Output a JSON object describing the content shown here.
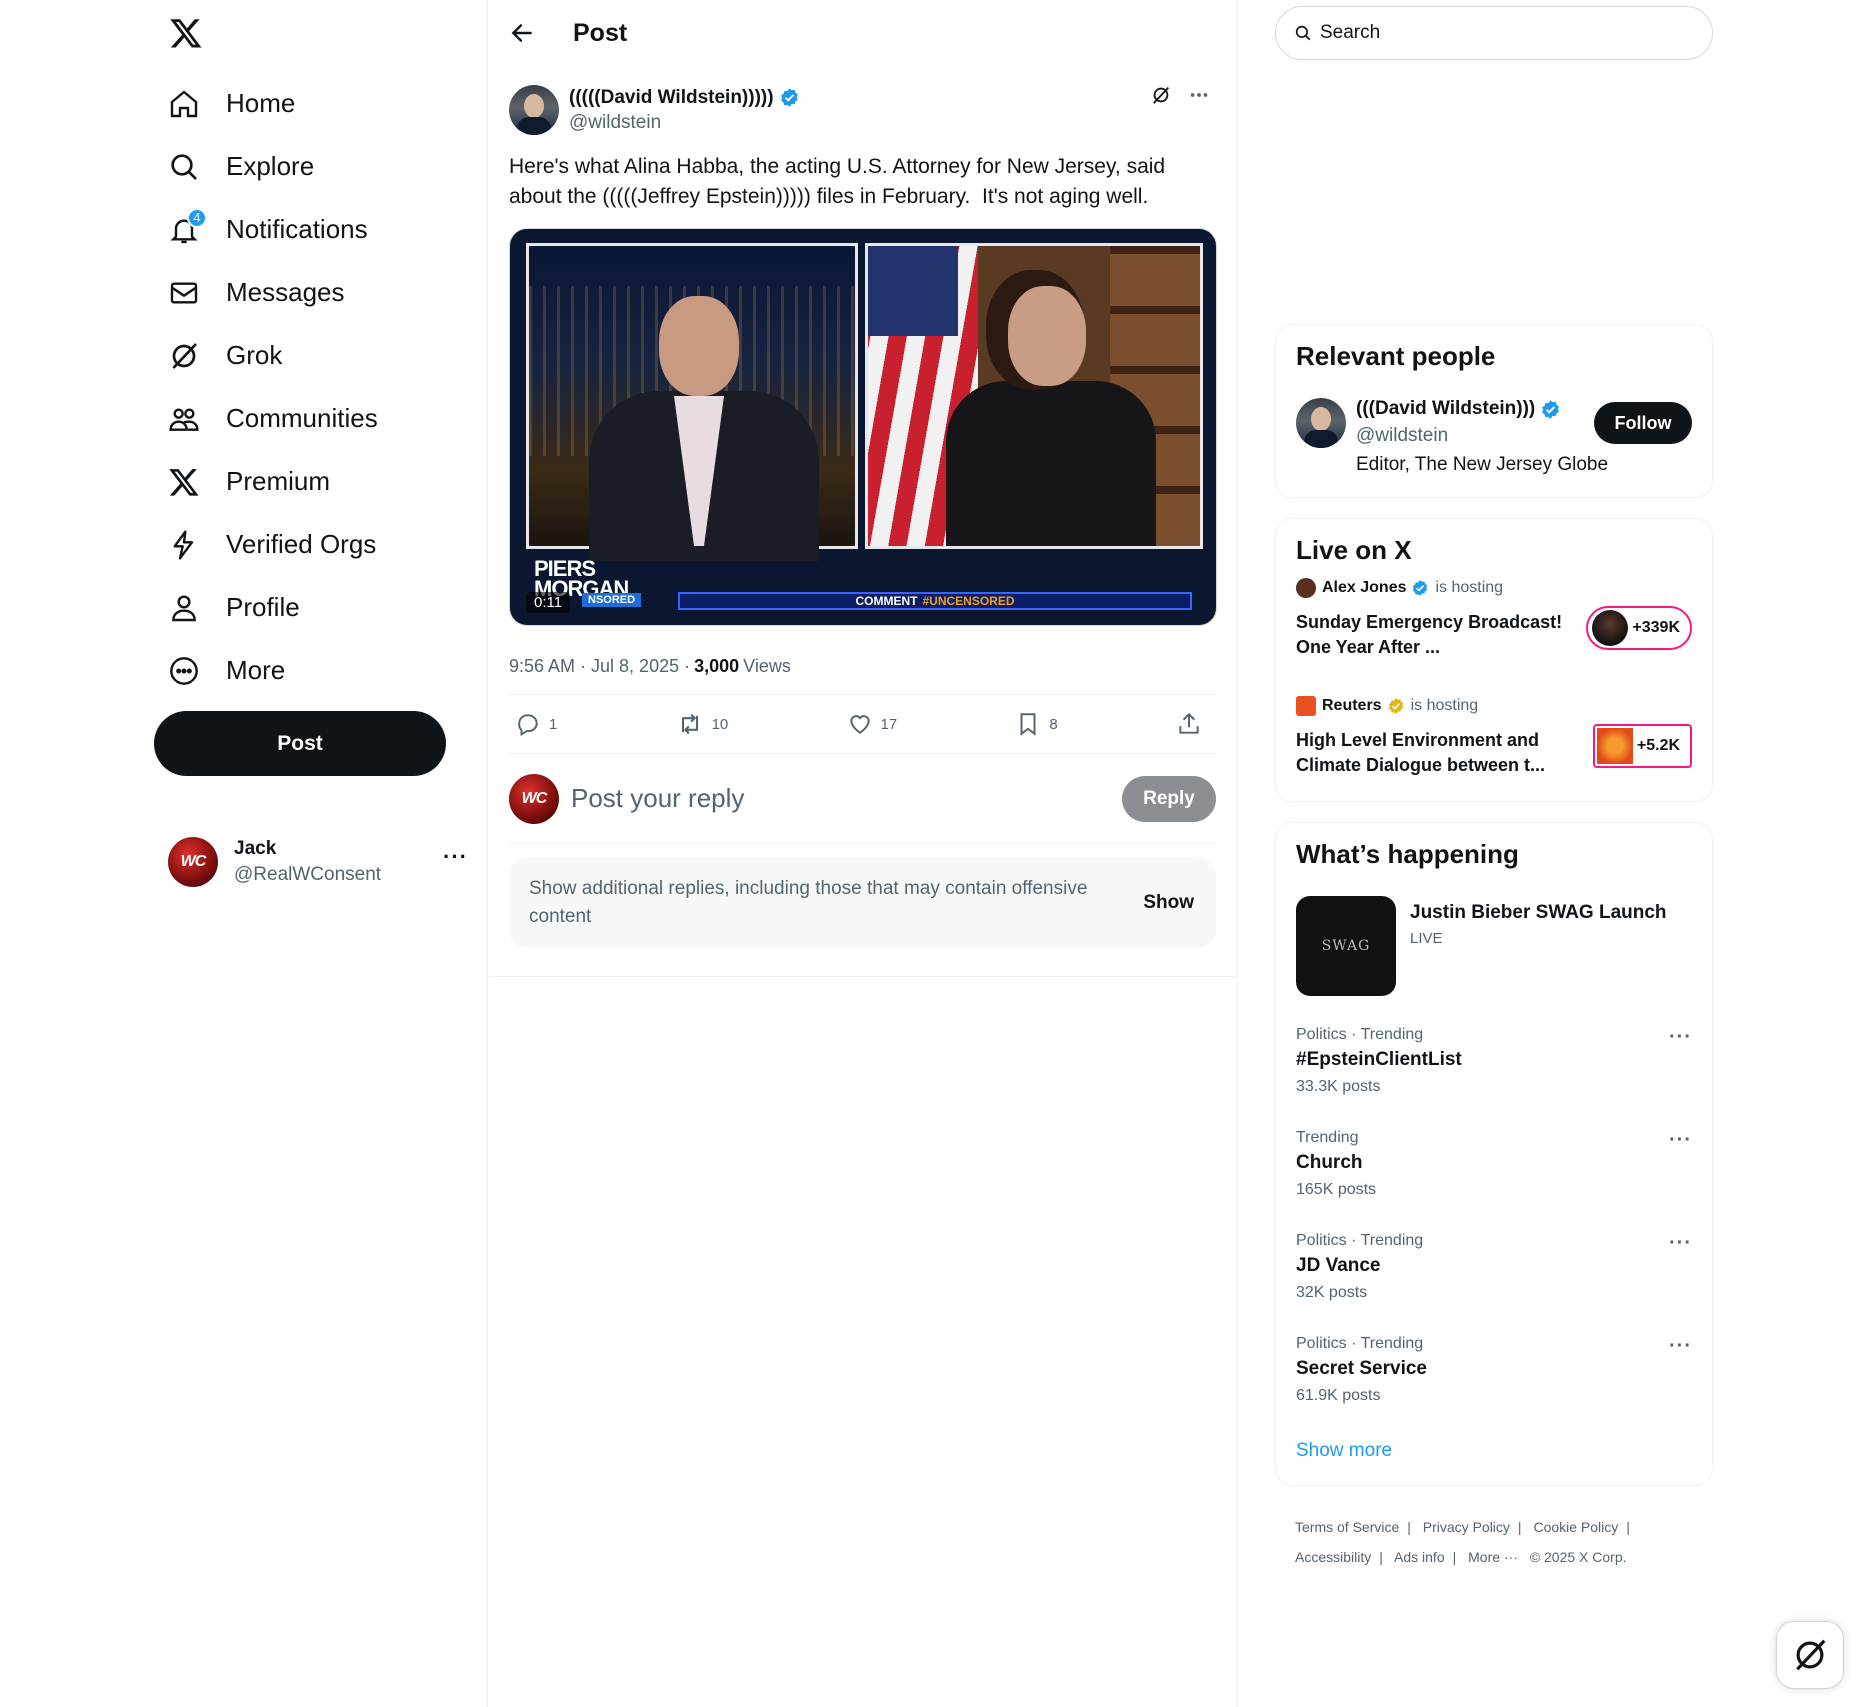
{
  "nav": {
    "logo_icon": "x-logo-icon",
    "items": [
      {
        "label": "Home",
        "icon": "home-icon"
      },
      {
        "label": "Explore",
        "icon": "search-icon"
      },
      {
        "label": "Notifications",
        "icon": "bell-icon",
        "badge": "4"
      },
      {
        "label": "Messages",
        "icon": "mail-icon"
      },
      {
        "label": "Grok",
        "icon": "grok-icon"
      },
      {
        "label": "Communities",
        "icon": "people-icon"
      },
      {
        "label": "Premium",
        "icon": "x-logo-icon"
      },
      {
        "label": "Verified Orgs",
        "icon": "lightning-icon"
      },
      {
        "label": "Profile",
        "icon": "person-icon"
      },
      {
        "label": "More",
        "icon": "more-circle-icon"
      }
    ],
    "post_button": "Post",
    "account": {
      "name": "Jack",
      "handle": "@RealWConsent",
      "avatar_text": "WC",
      "more": "···"
    }
  },
  "main": {
    "header_title": "Post",
    "tweet": {
      "name": "(((((David Wildstein)))))",
      "handle": "@wildstein",
      "text": "Here's what Alina Habba, the acting U.S. Attorney for New Jersey, said about the (((((Jeffrey Epstein))))) files in February.  It's not aging well.",
      "video": {
        "timecode": "0:11",
        "overlay_title": "PIERS\nMORGAN",
        "overlay_tag": "NSORED",
        "comment_bar": "COMMENT",
        "comment_tag": "#UNCENSORED"
      },
      "time": "9:56 AM · Jul 8, 2025 ·",
      "views": "3,000",
      "views_label": "Views",
      "actions": {
        "replies": "1",
        "reposts": "10",
        "likes": "17",
        "bookmarks": "8"
      }
    },
    "reply": {
      "placeholder": "Post your reply",
      "button": "Reply",
      "avatar_text": "WC"
    },
    "offensive": {
      "text": "Show additional replies, including those that may contain offensive content",
      "show": "Show"
    }
  },
  "sidebar": {
    "search_placeholder": "Search",
    "relevant_people": {
      "title": "Relevant people",
      "name": "(((David Wildstein)))",
      "handle": "@wildstein",
      "bio": "Editor, The New Jersey Globe",
      "follow": "Follow"
    },
    "live": {
      "title": "Live on X",
      "items": [
        {
          "host": "Alex Jones",
          "hosting": "is hosting",
          "title": "Sunday Emergency Broadcast! One Year After ...",
          "count": "+339K"
        },
        {
          "host": "Reuters",
          "hosting": "is hosting",
          "title": "High Level Environment and Climate Dialogue between t...",
          "count": "+5.2K"
        }
      ]
    },
    "happening": {
      "title": "What’s happening",
      "feature": {
        "image_text": "SWAG",
        "title": "Justin Bieber SWAG Launch",
        "status": "LIVE"
      },
      "trends": [
        {
          "context": "Politics · Trending",
          "name": "#EpsteinClientList",
          "count": "33.3K posts"
        },
        {
          "context": "Trending",
          "name": "Church",
          "count": "165K posts"
        },
        {
          "context": "Politics · Trending",
          "name": "JD Vance",
          "count": "32K posts"
        },
        {
          "context": "Politics · Trending",
          "name": "Secret Service",
          "count": "61.9K posts"
        }
      ],
      "show_more": "Show more"
    },
    "footer": {
      "line1": [
        "Terms of Service",
        "|",
        "Privacy Policy",
        "|",
        "Cookie Policy",
        "|"
      ],
      "line2": [
        "Accessibility",
        "|",
        "Ads info",
        "|",
        "More ···",
        "© 2025 X Corp."
      ]
    }
  },
  "colors": {
    "accent": "#1d9bf0",
    "text": "#0f1419",
    "muted": "#536471",
    "live": "#f91880"
  }
}
